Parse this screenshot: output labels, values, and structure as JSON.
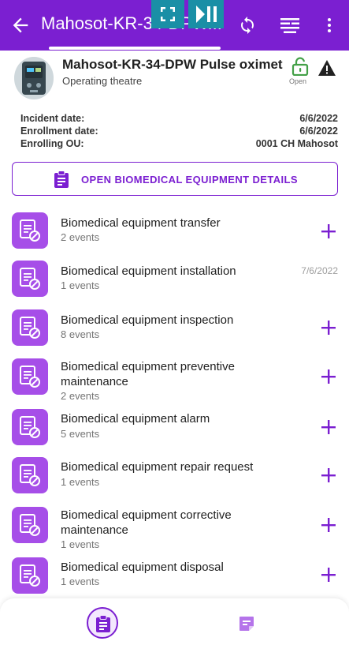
{
  "topbar": {
    "title": "Mahosot-KR-34-DPW...",
    "back_icon": "arrow-back-icon",
    "sync_icon": "sync-icon",
    "filter_icon": "filter-icon",
    "more_icon": "more-vert-icon"
  },
  "overlay": {
    "fullscreen_icon": "fullscreen-icon",
    "play_pause_icon": "play-pause-icon"
  },
  "header": {
    "name": "Mahosot-KR-34-DPW Pulse oximet",
    "subtitle": "Operating theatre",
    "lock_label": "Open",
    "lock_icon": "lock-open-icon",
    "warning_icon": "warning-icon"
  },
  "details": [
    {
      "label": "Incident date:",
      "value": "6/6/2022"
    },
    {
      "label": "Enrollment date:",
      "value": "6/6/2022"
    },
    {
      "label": "Enrolling OU:",
      "value": "0001 CH Mahosot"
    }
  ],
  "open_button": {
    "label": "OPEN BIOMEDICAL EQUIPMENT DETAILS",
    "icon": "clipboard-icon"
  },
  "stages": [
    {
      "name": "Biomedical equipment transfer",
      "count": "2 events",
      "action": "+"
    },
    {
      "name": "Biomedical equipment installation",
      "count": "1 events",
      "date": "7/6/2022"
    },
    {
      "name": "Biomedical equipment inspection",
      "count": "8 events",
      "action": "+"
    },
    {
      "name": "Biomedical equipment preventive maintenance",
      "count": "2 events",
      "action": "+"
    },
    {
      "name": "Biomedical equipment alarm",
      "count": "5 events",
      "action": "+"
    },
    {
      "name": "Biomedical equipment repair request",
      "count": "1 events",
      "action": "+"
    },
    {
      "name": "Biomedical equipment corrective maintenance",
      "count": "1 events",
      "action": "+"
    },
    {
      "name": "Biomedical equipment disposal",
      "count": "1 events",
      "action": "+"
    }
  ],
  "bottom_nav": {
    "dashboard_icon": "dashboard-clipboard-icon",
    "notes_icon": "notes-icon"
  },
  "colors": {
    "primary": "#7b1fd1",
    "stage_icon_bg": "#a64ee8",
    "lock_green": "#43a047"
  }
}
